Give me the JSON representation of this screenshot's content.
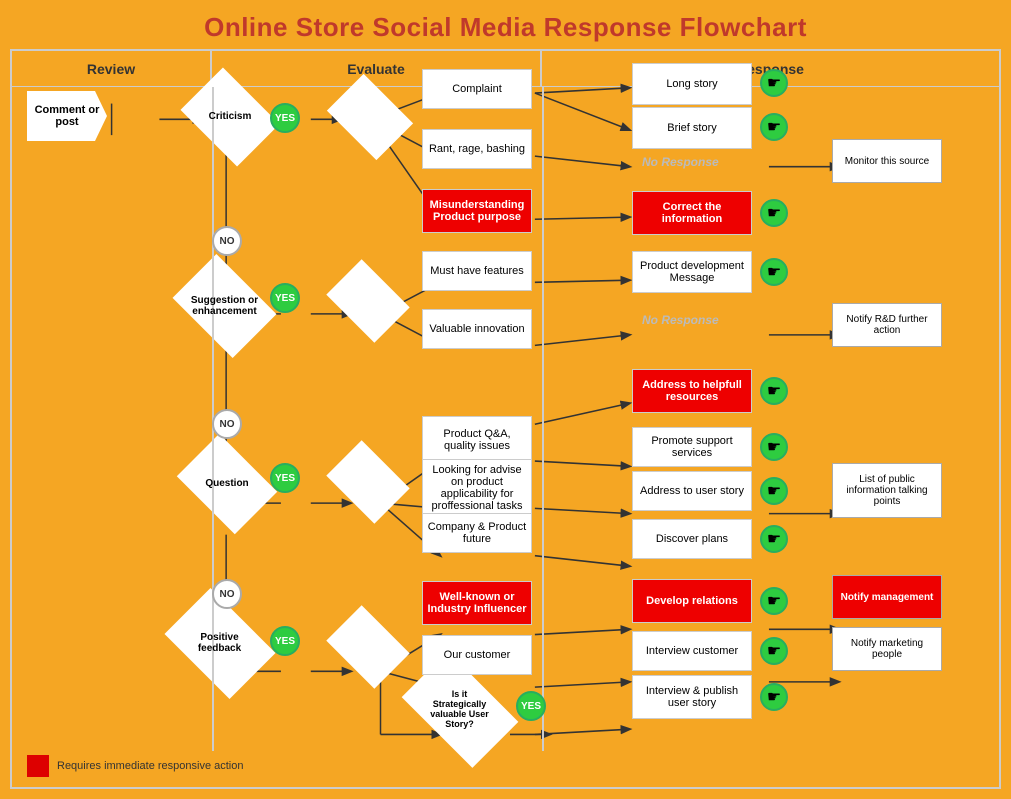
{
  "title": "Online Store Social Media Response Flowchart",
  "columns": {
    "review": "Review",
    "evaluate": "Evaluate",
    "response": "Response"
  },
  "nodes": {
    "comment_post": "Comment or post",
    "criticism": "Criticism",
    "suggestion": "Suggestion or enhancement",
    "question": "Question",
    "positive_feedback": "Positive feedback",
    "yes": "YES",
    "no": "NO",
    "complaint": "Complaint",
    "rant": "Rant, rage, bashing",
    "misunderstanding": "Misunderstanding Product purpose",
    "must_have": "Must have features",
    "valuable_innovation": "Valuable innovation",
    "product_qa": "Product Q&A, quality issues",
    "looking_for_advise": "Looking for advise on product applicability for proffessional tasks",
    "company_future": "Company & Product future",
    "well_known": "Well-known or Industry Influencer",
    "our_customer": "Our customer",
    "strategically_valuable": "Is it Strategically valuable User Story?",
    "long_story": "Long story",
    "brief_story": "Brief story",
    "no_response_1": "No Response",
    "correct_information": "Correct the information",
    "product_dev_message": "Product development Message",
    "no_response_2": "No Response",
    "address_helpful": "Address to helpfull resources",
    "promote_support": "Promote support services",
    "address_user_story": "Address to user story",
    "discover_plans": "Discover plans",
    "develop_relations": "Develop relations",
    "interview_customer": "Interview customer",
    "interview_publish": "Interview & publish user story",
    "monitor_source": "Monitor this source",
    "notify_rd": "Notify R&D further action",
    "list_public": "List of public information talking points",
    "notify_management": "Notify management",
    "notify_marketing": "Notify marketing people"
  },
  "legend": {
    "box_color": "#dd0000",
    "text": "Requires immediate responsive action"
  }
}
